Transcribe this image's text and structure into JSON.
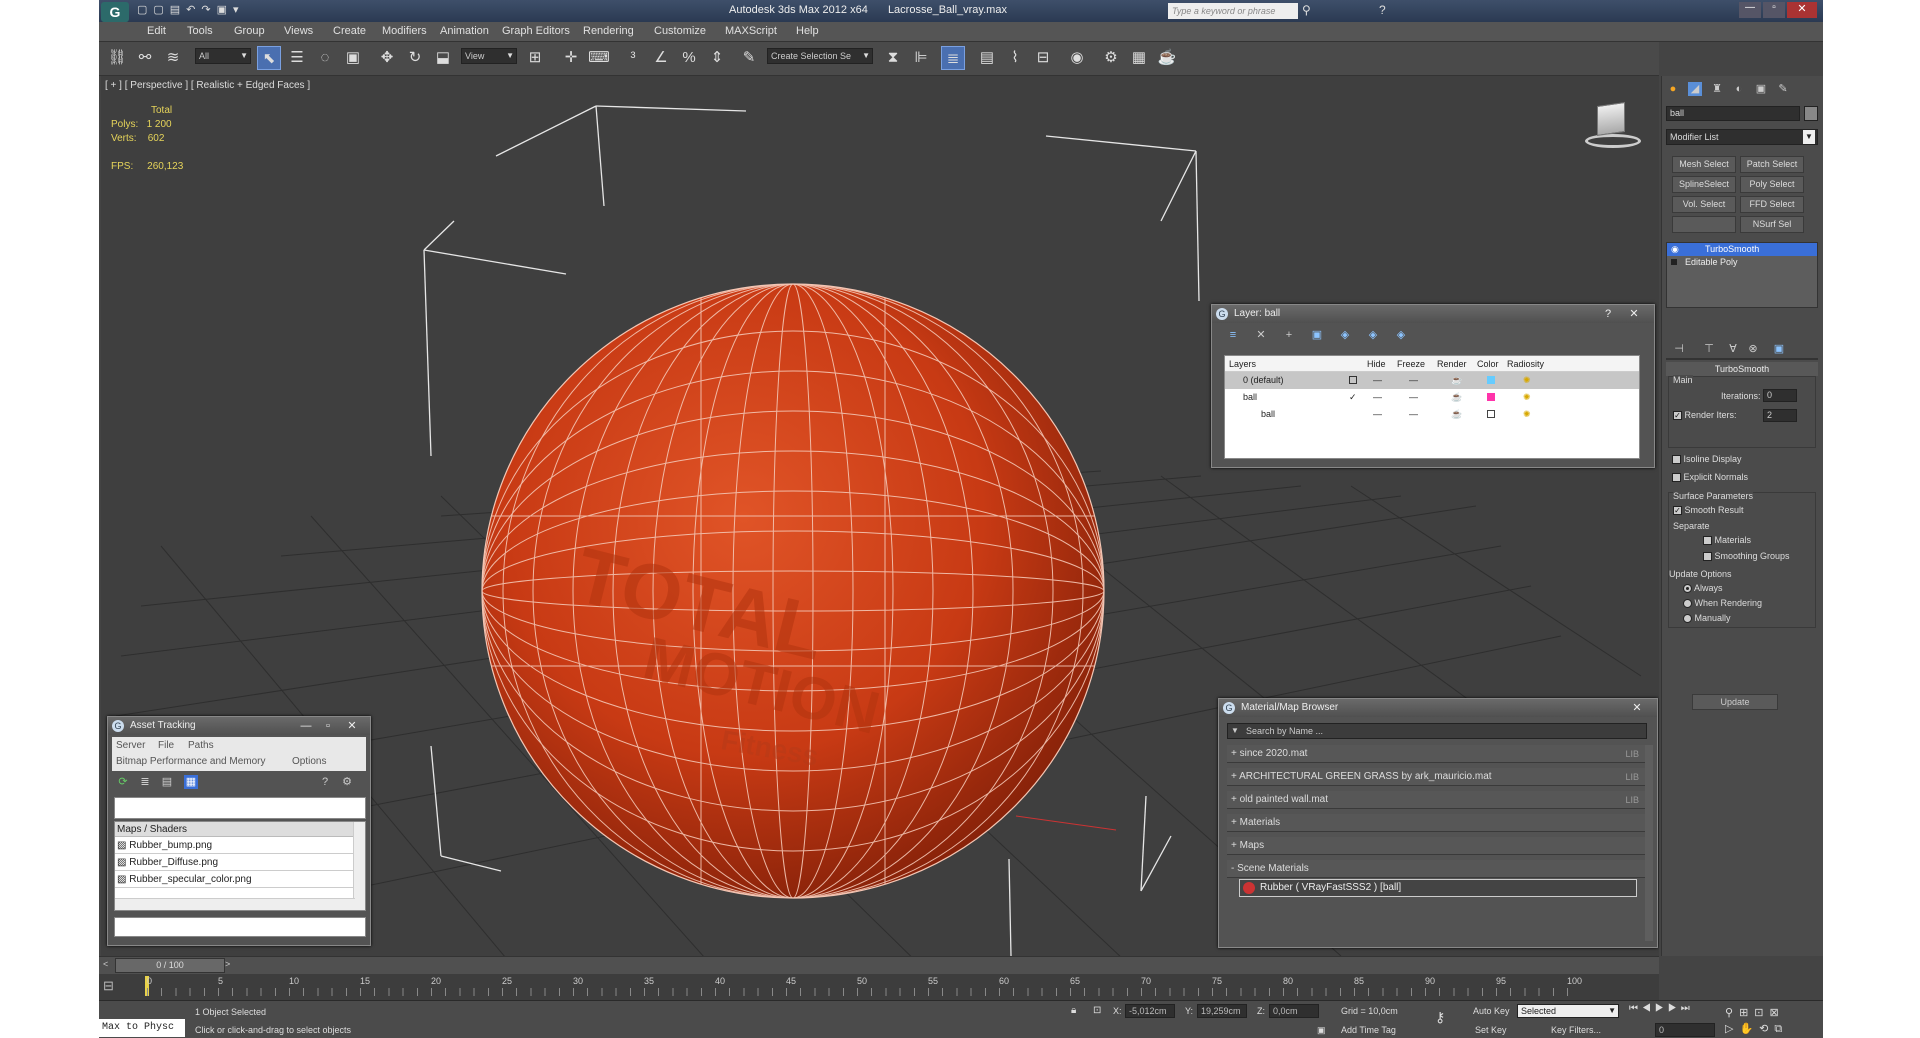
{
  "titlebar": {
    "title": "Autodesk 3ds Max 2012 x64",
    "filename": "Lacrosse_Ball_vray.max",
    "search_placeholder": "Type a keyword or phrase"
  },
  "menu": [
    "Edit",
    "Tools",
    "Group",
    "Views",
    "Create",
    "Modifiers",
    "Animation",
    "Graph Editors",
    "Rendering",
    "Customize",
    "MAXScript",
    "Help"
  ],
  "toolbar": {
    "selection_filter": "All",
    "ref_coord": "View",
    "named_selection": "Create Selection Se"
  },
  "viewport": {
    "label": "[ + ] [ Perspective ] [ Realistic + Edged Faces ]",
    "stats": {
      "total_label": "Total",
      "polys_label": "Polys:",
      "polys": "1 200",
      "verts_label": "Verts:",
      "verts": "602",
      "fps_label": "FPS:",
      "fps": "260,123"
    },
    "watermark": "TOTAL",
    "watermark2": "MOTION",
    "watermark3": "Fitness"
  },
  "layer_window": {
    "title": "Layer: ball",
    "columns": [
      "Layers",
      "Hide",
      "Freeze",
      "Render",
      "Color",
      "Radiosity"
    ],
    "rows": [
      {
        "name": "0 (default)"
      },
      {
        "name": "ball"
      },
      {
        "name": "ball"
      }
    ]
  },
  "asset_window": {
    "title": "Asset Tracking",
    "menu1": [
      "Server",
      "File",
      "Paths"
    ],
    "menu2": [
      "Bitmap Performance and Memory",
      "Options"
    ],
    "header": "Maps / Shaders",
    "items": [
      "Rubber_bump.png",
      "Rubber_Diffuse.png",
      "Rubber_specular_color.png"
    ]
  },
  "material_browser": {
    "title": "Material/Map Browser",
    "search_placeholder": "Search by Name ...",
    "rows": [
      {
        "label": "+ since 2020.mat",
        "lib": "LIB"
      },
      {
        "label": "+ ARCHITECTURAL GREEN GRASS by ark_mauricio.mat",
        "lib": "LIB"
      },
      {
        "label": "+ old painted wall.mat",
        "lib": "LIB"
      },
      {
        "label": "+ Materials",
        "lib": ""
      },
      {
        "label": "+ Maps",
        "lib": ""
      },
      {
        "label": "- Scene Materials",
        "lib": ""
      }
    ],
    "scene_material": "Rubber  ( VRayFastSSS2 )  [ball]"
  },
  "command_panel": {
    "object_name": "ball",
    "modifier_list": "Modifier List",
    "buttons": [
      "Mesh Select",
      "Patch Select",
      "SplineSelect",
      "Poly Select",
      "Vol. Select",
      "FFD Select",
      "",
      "NSurf Sel"
    ],
    "stack": [
      "TurboSmooth",
      "Editable Poly"
    ],
    "rollout_title": "TurboSmooth",
    "main_label": "Main",
    "iterations_label": "Iterations:",
    "iterations": "0",
    "render_iters_label": "Render Iters:",
    "render_iters": "2",
    "isoline": "Isoline Display",
    "explicit": "Explicit Normals",
    "surface_label": "Surface Parameters",
    "smooth_result": "Smooth Result",
    "separate_label": "Separate",
    "materials": "Materials",
    "smoothing_groups": "Smoothing Groups",
    "update_label": "Update Options",
    "always": "Always",
    "when_rendering": "When Rendering",
    "manually": "Manually",
    "update_btn": "Update"
  },
  "timeline": {
    "frame": "0 / 100",
    "ticks": [
      "0",
      "5",
      "10",
      "15",
      "20",
      "25",
      "30",
      "35",
      "40",
      "45",
      "50",
      "55",
      "60",
      "65",
      "70",
      "75",
      "80",
      "85",
      "90",
      "95",
      "100"
    ]
  },
  "statusbar": {
    "maxscript": "Max to Physc",
    "selected": "1 Object Selected",
    "prompt": "Click or click-and-drag to select objects",
    "x_label": "X:",
    "x": "-5,012cm",
    "y_label": "Y:",
    "y": "19,259cm",
    "z_label": "Z:",
    "z": "0,0cm",
    "grid": "Grid = 10,0cm",
    "add_time_tag": "Add Time Tag",
    "auto_key": "Auto Key",
    "set_key": "Set Key",
    "selected_dd": "Selected",
    "key_filters": "Key Filters...",
    "frame_field": "0"
  },
  "colors": {
    "ball": "#c83a14",
    "title_bg": "#2b3a52",
    "stack_highlight": "#3a6fd8"
  }
}
